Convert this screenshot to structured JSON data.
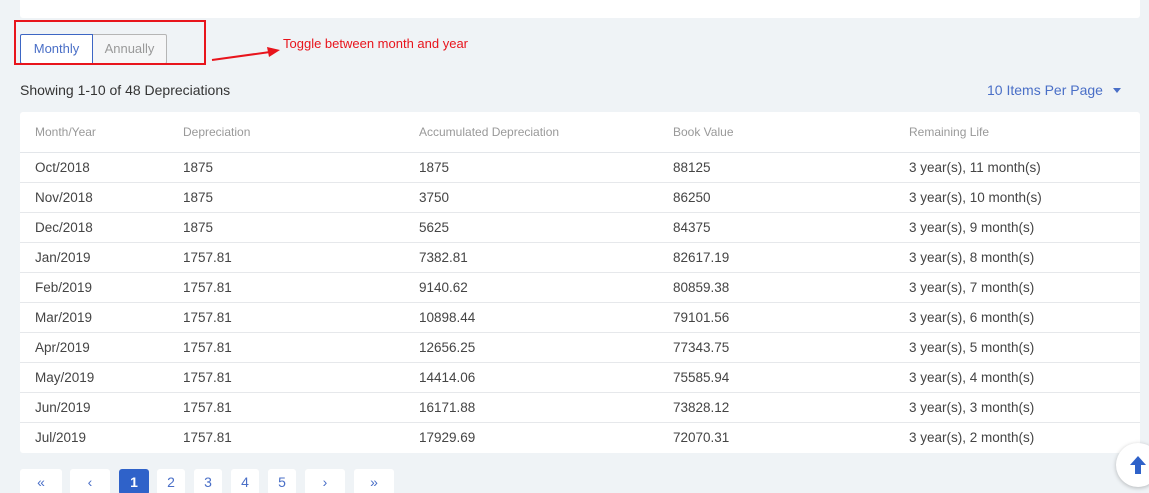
{
  "toggle": {
    "monthly_label": "Monthly",
    "annually_label": "Annually"
  },
  "annotation": {
    "text": "Toggle between month and year",
    "color": "#e8141c"
  },
  "summary": {
    "showing_text": "Showing 1-10 of 48 Depreciations"
  },
  "per_page": {
    "label": "10 Items Per Page"
  },
  "table": {
    "headers": [
      "Month/Year",
      "Depreciation",
      "Accumulated Depreciation",
      "Book Value",
      "Remaining Life"
    ],
    "rows": [
      [
        "Oct/2018",
        "1875",
        "1875",
        "88125",
        "3 year(s), 11 month(s)"
      ],
      [
        "Nov/2018",
        "1875",
        "3750",
        "86250",
        "3 year(s), 10 month(s)"
      ],
      [
        "Dec/2018",
        "1875",
        "5625",
        "84375",
        "3 year(s), 9 month(s)"
      ],
      [
        "Jan/2019",
        "1757.81",
        "7382.81",
        "82617.19",
        "3 year(s), 8 month(s)"
      ],
      [
        "Feb/2019",
        "1757.81",
        "9140.62",
        "80859.38",
        "3 year(s), 7 month(s)"
      ],
      [
        "Mar/2019",
        "1757.81",
        "10898.44",
        "79101.56",
        "3 year(s), 6 month(s)"
      ],
      [
        "Apr/2019",
        "1757.81",
        "12656.25",
        "77343.75",
        "3 year(s), 5 month(s)"
      ],
      [
        "May/2019",
        "1757.81",
        "14414.06",
        "75585.94",
        "3 year(s), 4 month(s)"
      ],
      [
        "Jun/2019",
        "1757.81",
        "16171.88",
        "73828.12",
        "3 year(s), 3 month(s)"
      ],
      [
        "Jul/2019",
        "1757.81",
        "17929.69",
        "72070.31",
        "3 year(s), 2 month(s)"
      ]
    ]
  },
  "pagination": {
    "first": "«",
    "prev": "‹",
    "pages": [
      "1",
      "2",
      "3",
      "4",
      "5"
    ],
    "current_page": "1",
    "next": "›",
    "last": "»"
  },
  "colors": {
    "accent": "#2f62c9",
    "link": "#4a6fc7",
    "background": "#eff3f6"
  }
}
